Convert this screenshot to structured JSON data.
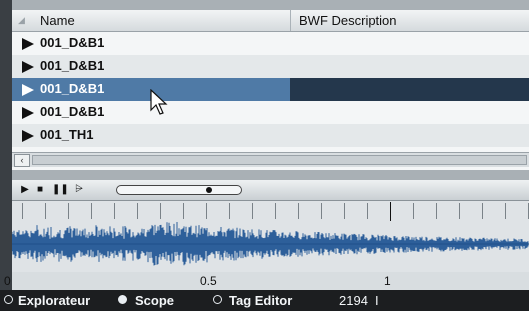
{
  "list": {
    "columns": [
      "Name",
      "BWF Description"
    ],
    "rows": [
      {
        "name": "001_D&B1"
      },
      {
        "name": "001_D&B1"
      },
      {
        "name": "001_D&B1",
        "selected": true
      },
      {
        "name": "001_D&B1"
      },
      {
        "name": "001_TH1"
      }
    ]
  },
  "transport": {
    "play_glyph": "▶",
    "stop_glyph": "■",
    "pause_glyph": "❚❚",
    "loop_glyph": "⩥",
    "progress": 0.75
  },
  "timeline": {
    "labels": [
      "0",
      "0.5",
      "1"
    ]
  },
  "statusbar": {
    "items": [
      {
        "label": "Explorateur",
        "selected": false
      },
      {
        "label": "Scope",
        "selected": true
      },
      {
        "label": "Tag Editor",
        "selected": false
      }
    ],
    "value": "2194",
    "trailing": "I"
  },
  "colors": {
    "selection": "#4f7aa6",
    "selection_dark": "#24374c",
    "waveform": "#2d5f9a",
    "statusbar": "#1c1e20"
  }
}
